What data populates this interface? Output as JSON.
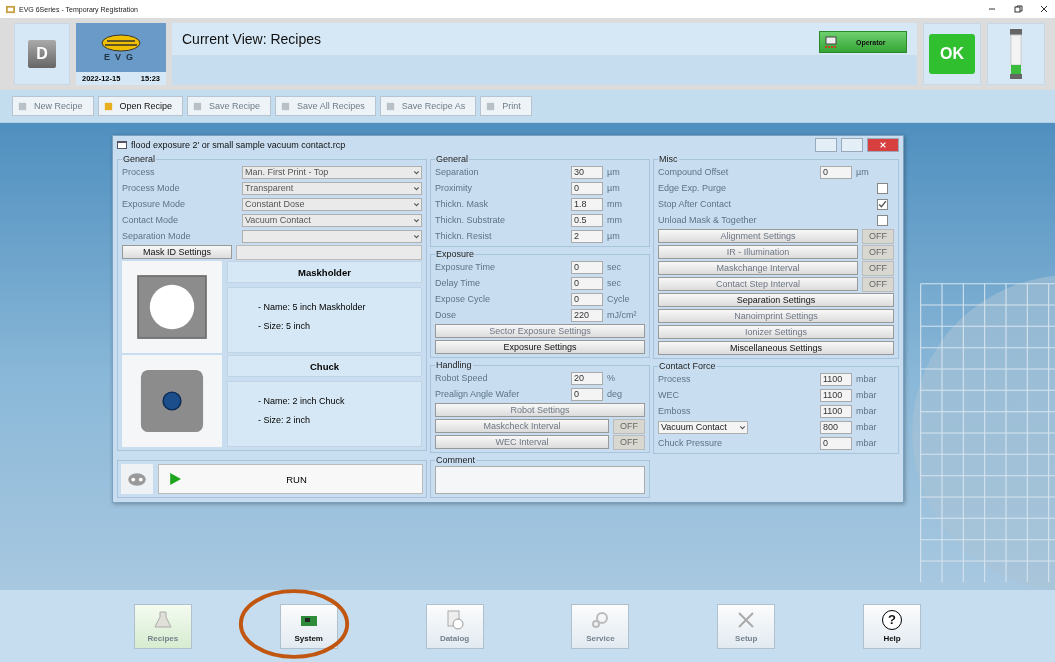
{
  "window": {
    "title": "EVG 6Series - Temporary Registration"
  },
  "header": {
    "user_initial": "D",
    "logo": "EVG",
    "date": "2022-12-15",
    "time": "15:23",
    "current_view": "Current View: Recipes",
    "operator": "Operator",
    "status": "OK"
  },
  "toolbar": [
    {
      "label": "New Recipe",
      "disabled": true
    },
    {
      "label": "Open Recipe",
      "disabled": false
    },
    {
      "label": "Save Recipe",
      "disabled": true
    },
    {
      "label": "Save All Recipes",
      "disabled": true
    },
    {
      "label": "Save Recipe As",
      "disabled": true
    },
    {
      "label": "Print",
      "disabled": true
    }
  ],
  "dialog": {
    "title": "flood exposure 2' or small sample vacuum contact.rcp",
    "general": {
      "title": "General",
      "fields": [
        {
          "label": "Process",
          "value": "Man. First Print - Top"
        },
        {
          "label": "Process Mode",
          "value": "Transparent"
        },
        {
          "label": "Exposure Mode",
          "value": "Constant Dose"
        },
        {
          "label": "Contact Mode",
          "value": "Vacuum Contact"
        },
        {
          "label": "Separation Mode"
        }
      ],
      "mask_id_button": "Mask ID Settings",
      "cards": [
        {
          "kind": "maskholder",
          "title": "Maskholder",
          "lines": [
            "- Name: 5 inch Maskholder",
            "- Size: 5 inch"
          ]
        },
        {
          "kind": "chuck",
          "title": "Chuck",
          "lines": [
            "- Name: 2 inch Chuck",
            "- Size: 2 inch"
          ]
        }
      ],
      "run_button": "RUN"
    },
    "parameters": {
      "title": "General",
      "rows": [
        {
          "label": "Separation",
          "value": "30",
          "unit": "µm"
        },
        {
          "label": "Proximity",
          "value": "0",
          "unit": "µm"
        },
        {
          "label": "Thickn. Mask",
          "value": "1.8",
          "unit": "mm"
        },
        {
          "label": "Thickn. Substrate",
          "value": "0.5",
          "unit": "mm"
        },
        {
          "label": "Thickn. Resist",
          "value": "2",
          "unit": "µm"
        }
      ]
    },
    "exposure": {
      "title": "Exposure",
      "rows": [
        {
          "label": "Exposure Time",
          "value": "0",
          "unit": "sec"
        },
        {
          "label": "Delay Time",
          "value": "0",
          "unit": "sec"
        },
        {
          "label": "Expose Cycle",
          "value": "0",
          "unit": "Cycle"
        },
        {
          "label": "Dose",
          "value": "220",
          "unit": "mJ/cm²"
        }
      ],
      "buttons": [
        {
          "label": "Sector Exposure Settings",
          "disabled": true
        },
        {
          "label": "Exposure Settings",
          "disabled": false
        }
      ]
    },
    "handling": {
      "title": "Handling",
      "rows": [
        {
          "label": "Robot Speed",
          "value": "20",
          "unit": "%"
        },
        {
          "label": "Prealign Angle Wafer",
          "value": "0",
          "unit": "deg"
        }
      ],
      "buttons": [
        {
          "label": "Robot Settings",
          "disabled": true
        }
      ],
      "toggles": [
        {
          "label": "Maskcheck Interval",
          "state": "OFF"
        },
        {
          "label": "WEC Interval",
          "state": "OFF"
        }
      ]
    },
    "comment": {
      "title": "Comment"
    },
    "misc": {
      "title": "Misc",
      "items": [
        {
          "kind": "number",
          "label": "Compound Offset",
          "value": "0",
          "unit": "µm"
        },
        {
          "kind": "check",
          "label": "Edge Exp. Purge",
          "checked": false
        },
        {
          "kind": "check",
          "label": "Stop After Contact",
          "checked": true
        },
        {
          "kind": "check",
          "label": "Unload Mask & Together",
          "checked": false
        }
      ],
      "toggles": [
        {
          "label": "Alignment Settings",
          "state": "OFF"
        },
        {
          "label": "IR - Illumination",
          "state": "OFF"
        },
        {
          "label": "Maskchange Interval",
          "state": "OFF"
        },
        {
          "label": "Contact Step Interval",
          "state": "OFF"
        }
      ],
      "buttons": [
        {
          "label": "Separation Settings",
          "disabled": false
        },
        {
          "label": "Nanoimprint Settings",
          "disabled": true
        },
        {
          "label": "Ionizer Settings",
          "disabled": true
        },
        {
          "label": "Miscellaneous Settings",
          "disabled": false
        }
      ]
    },
    "contact_force": {
      "title": "Contact Force",
      "rows": [
        {
          "kind": "label",
          "label": "Process",
          "value": "1100",
          "unit": "mbar"
        },
        {
          "kind": "label",
          "label": "WEC",
          "value": "1100",
          "unit": "mbar"
        },
        {
          "kind": "label",
          "label": "Emboss",
          "value": "1100",
          "unit": "mbar"
        },
        {
          "kind": "select",
          "label": "Vacuum Contact",
          "value": "800",
          "unit": "mbar"
        },
        {
          "kind": "label",
          "label": "Chuck Pressure",
          "value": "0",
          "unit": "mbar"
        }
      ]
    }
  },
  "navigation": [
    {
      "label": "Recipes",
      "selected": true,
      "disabled": true,
      "kind": "recipes"
    },
    {
      "label": "System",
      "selected": false,
      "disabled": false,
      "kind": "system"
    },
    {
      "label": "Datalog",
      "selected": false,
      "disabled": true,
      "kind": "datalog"
    },
    {
      "label": "Service",
      "selected": false,
      "disabled": true,
      "kind": "service"
    },
    {
      "label": "Setup",
      "selected": false,
      "disabled": true,
      "kind": "setup"
    },
    {
      "label": "Help",
      "selected": false,
      "disabled": false,
      "kind": "help",
      "symbol": "?"
    }
  ]
}
